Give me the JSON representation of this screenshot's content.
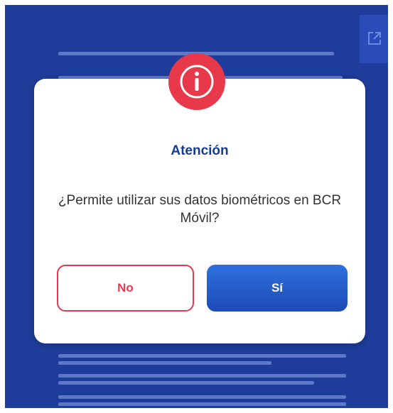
{
  "dialog": {
    "title": "Atención",
    "message": "¿Permite utilizar sus datos biométricos en BCR Móvil?",
    "no_label": "No",
    "yes_label": "Sí"
  },
  "colors": {
    "background_blue": "#1e3d9a",
    "alert_red": "#e8394a",
    "title_blue": "#153c8e",
    "button_blue": "#2356c8"
  },
  "icons": {
    "alert": "info-icon",
    "corner": "open-external-icon"
  }
}
